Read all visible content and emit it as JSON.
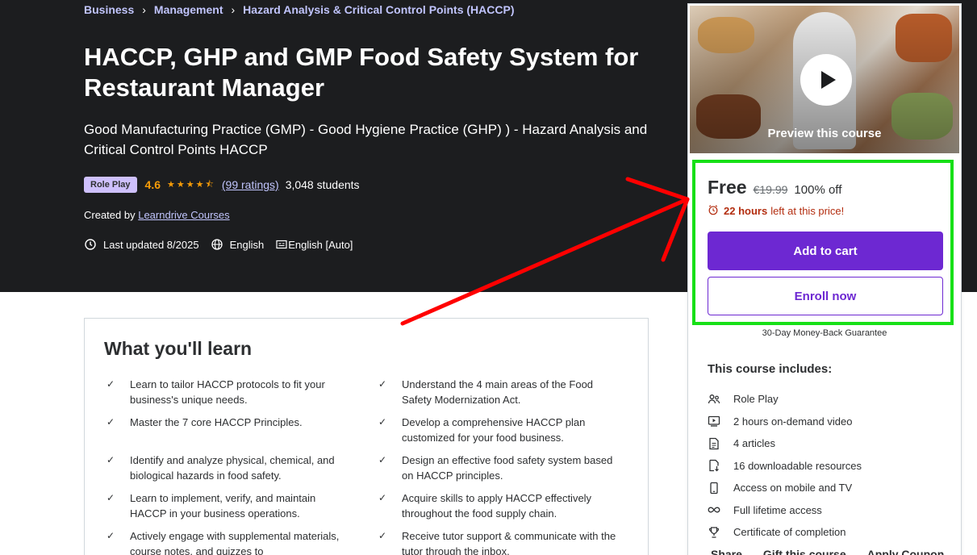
{
  "breadcrumb": [
    "Business",
    "Management",
    "Hazard Analysis & Critical Control Points (HACCP)"
  ],
  "title": "HACCP, GHP and GMP Food Safety System for Restaurant Manager",
  "subtitle": "Good Manufacturing Practice (GMP) - Good Hygiene Practice (GHP) ) - Hazard Analysis and Critical Control Points HACCP",
  "badge": "Role Play",
  "rating": "4.6",
  "rating_stars": 4.6,
  "ratings_count": "(99 ratings)",
  "students": "3,048 students",
  "created_by_label": "Created by",
  "instructor": "Learndrive Courses",
  "last_updated": "Last updated 8/2025",
  "language": "English",
  "captions": "English [Auto]",
  "sidebar": {
    "preview_label": "Preview this course",
    "price": "Free",
    "original_price": "€19.99",
    "discount": "100% off",
    "timer_bold": "22 hours",
    "timer_rest": "left at this price!",
    "add_to_cart": "Add to cart",
    "enroll_now": "Enroll now",
    "guarantee": "30-Day Money-Back Guarantee",
    "includes_title": "This course includes:",
    "includes": [
      {
        "icon": "role-play-icon",
        "label": "Role Play"
      },
      {
        "icon": "video-icon",
        "label": "2 hours on-demand video"
      },
      {
        "icon": "article-icon",
        "label": "4 articles"
      },
      {
        "icon": "download-icon",
        "label": "16 downloadable resources"
      },
      {
        "icon": "mobile-icon",
        "label": "Access on mobile and TV"
      },
      {
        "icon": "infinity-icon",
        "label": "Full lifetime access"
      },
      {
        "icon": "trophy-icon",
        "label": "Certificate of completion"
      }
    ],
    "share": "Share",
    "gift": "Gift this course",
    "coupon": "Apply Coupon"
  },
  "learn": {
    "title": "What you'll learn",
    "items": [
      "Learn to tailor HACCP protocols to fit your business's unique needs.",
      "Understand the 4 main areas of the Food Safety Modernization Act.",
      "Master the 7 core HACCP Principles.",
      "Develop a comprehensive HACCP plan customized for your food business.",
      "Identify and analyze physical, chemical, and biological hazards in food safety.",
      "Design an effective food safety system based on HACCP principles.",
      "Learn to implement, verify, and maintain HACCP in your business operations.",
      "Acquire skills to apply HACCP effectively throughout the food supply chain.",
      "Actively engage with supplemental materials, course notes, and quizzes to",
      "Receive tutor support & communicate with the tutor through the inbox."
    ]
  },
  "colors": {
    "hero_bg": "#1c1d1f",
    "accent_purple": "#6d28d2",
    "link_lavender": "#c0c4fc",
    "star_orange": "#f69c08",
    "timer_red": "#b32d0f",
    "highlight_green": "#17e017",
    "arrow_red": "#ff0000"
  }
}
